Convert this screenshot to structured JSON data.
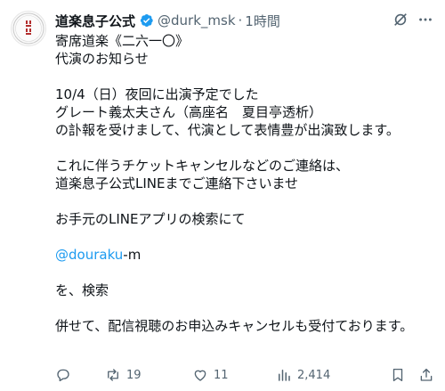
{
  "author": {
    "display_name": "道楽息子公式",
    "handle": "@durk_msk",
    "separator": "·",
    "time": "1時間",
    "avatar_text": "道楽息子"
  },
  "post": {
    "lines": [
      "寄席道楽《二六一〇》",
      "代演のお知らせ",
      "",
      "10/4（日）夜回に出演予定でした",
      "グレート義太夫さん（高座名　夏目亭透析）",
      "の訃報を受けまして、代演として表情豊が出演致します。",
      "",
      "これに伴うチケットキャンセルなどのご連絡は、",
      "道楽息子公式LINEまでご連絡下さいませ",
      "",
      "お手元のLINEアプリの検索にて",
      "",
      "",
      "",
      "を、検索",
      "",
      "併せて、配信視聴のお申込みキャンセルも受付ております。"
    ],
    "mention": "@douraku",
    "mention_suffix": "-m"
  },
  "stats": {
    "replies": "",
    "retweets": "19",
    "likes": "11",
    "views": "2,414"
  },
  "colors": {
    "text": "#0f1419",
    "muted": "#536471",
    "link": "#1d9bf0",
    "verified": "#1d9bf0"
  },
  "icons": {
    "verified": "verified-badge-icon",
    "grok": "grok-icon",
    "more": "more-icon",
    "reply": "reply-icon",
    "retweet": "retweet-icon",
    "like": "like-icon",
    "views": "views-icon",
    "bookmark": "bookmark-icon",
    "share": "share-icon"
  }
}
